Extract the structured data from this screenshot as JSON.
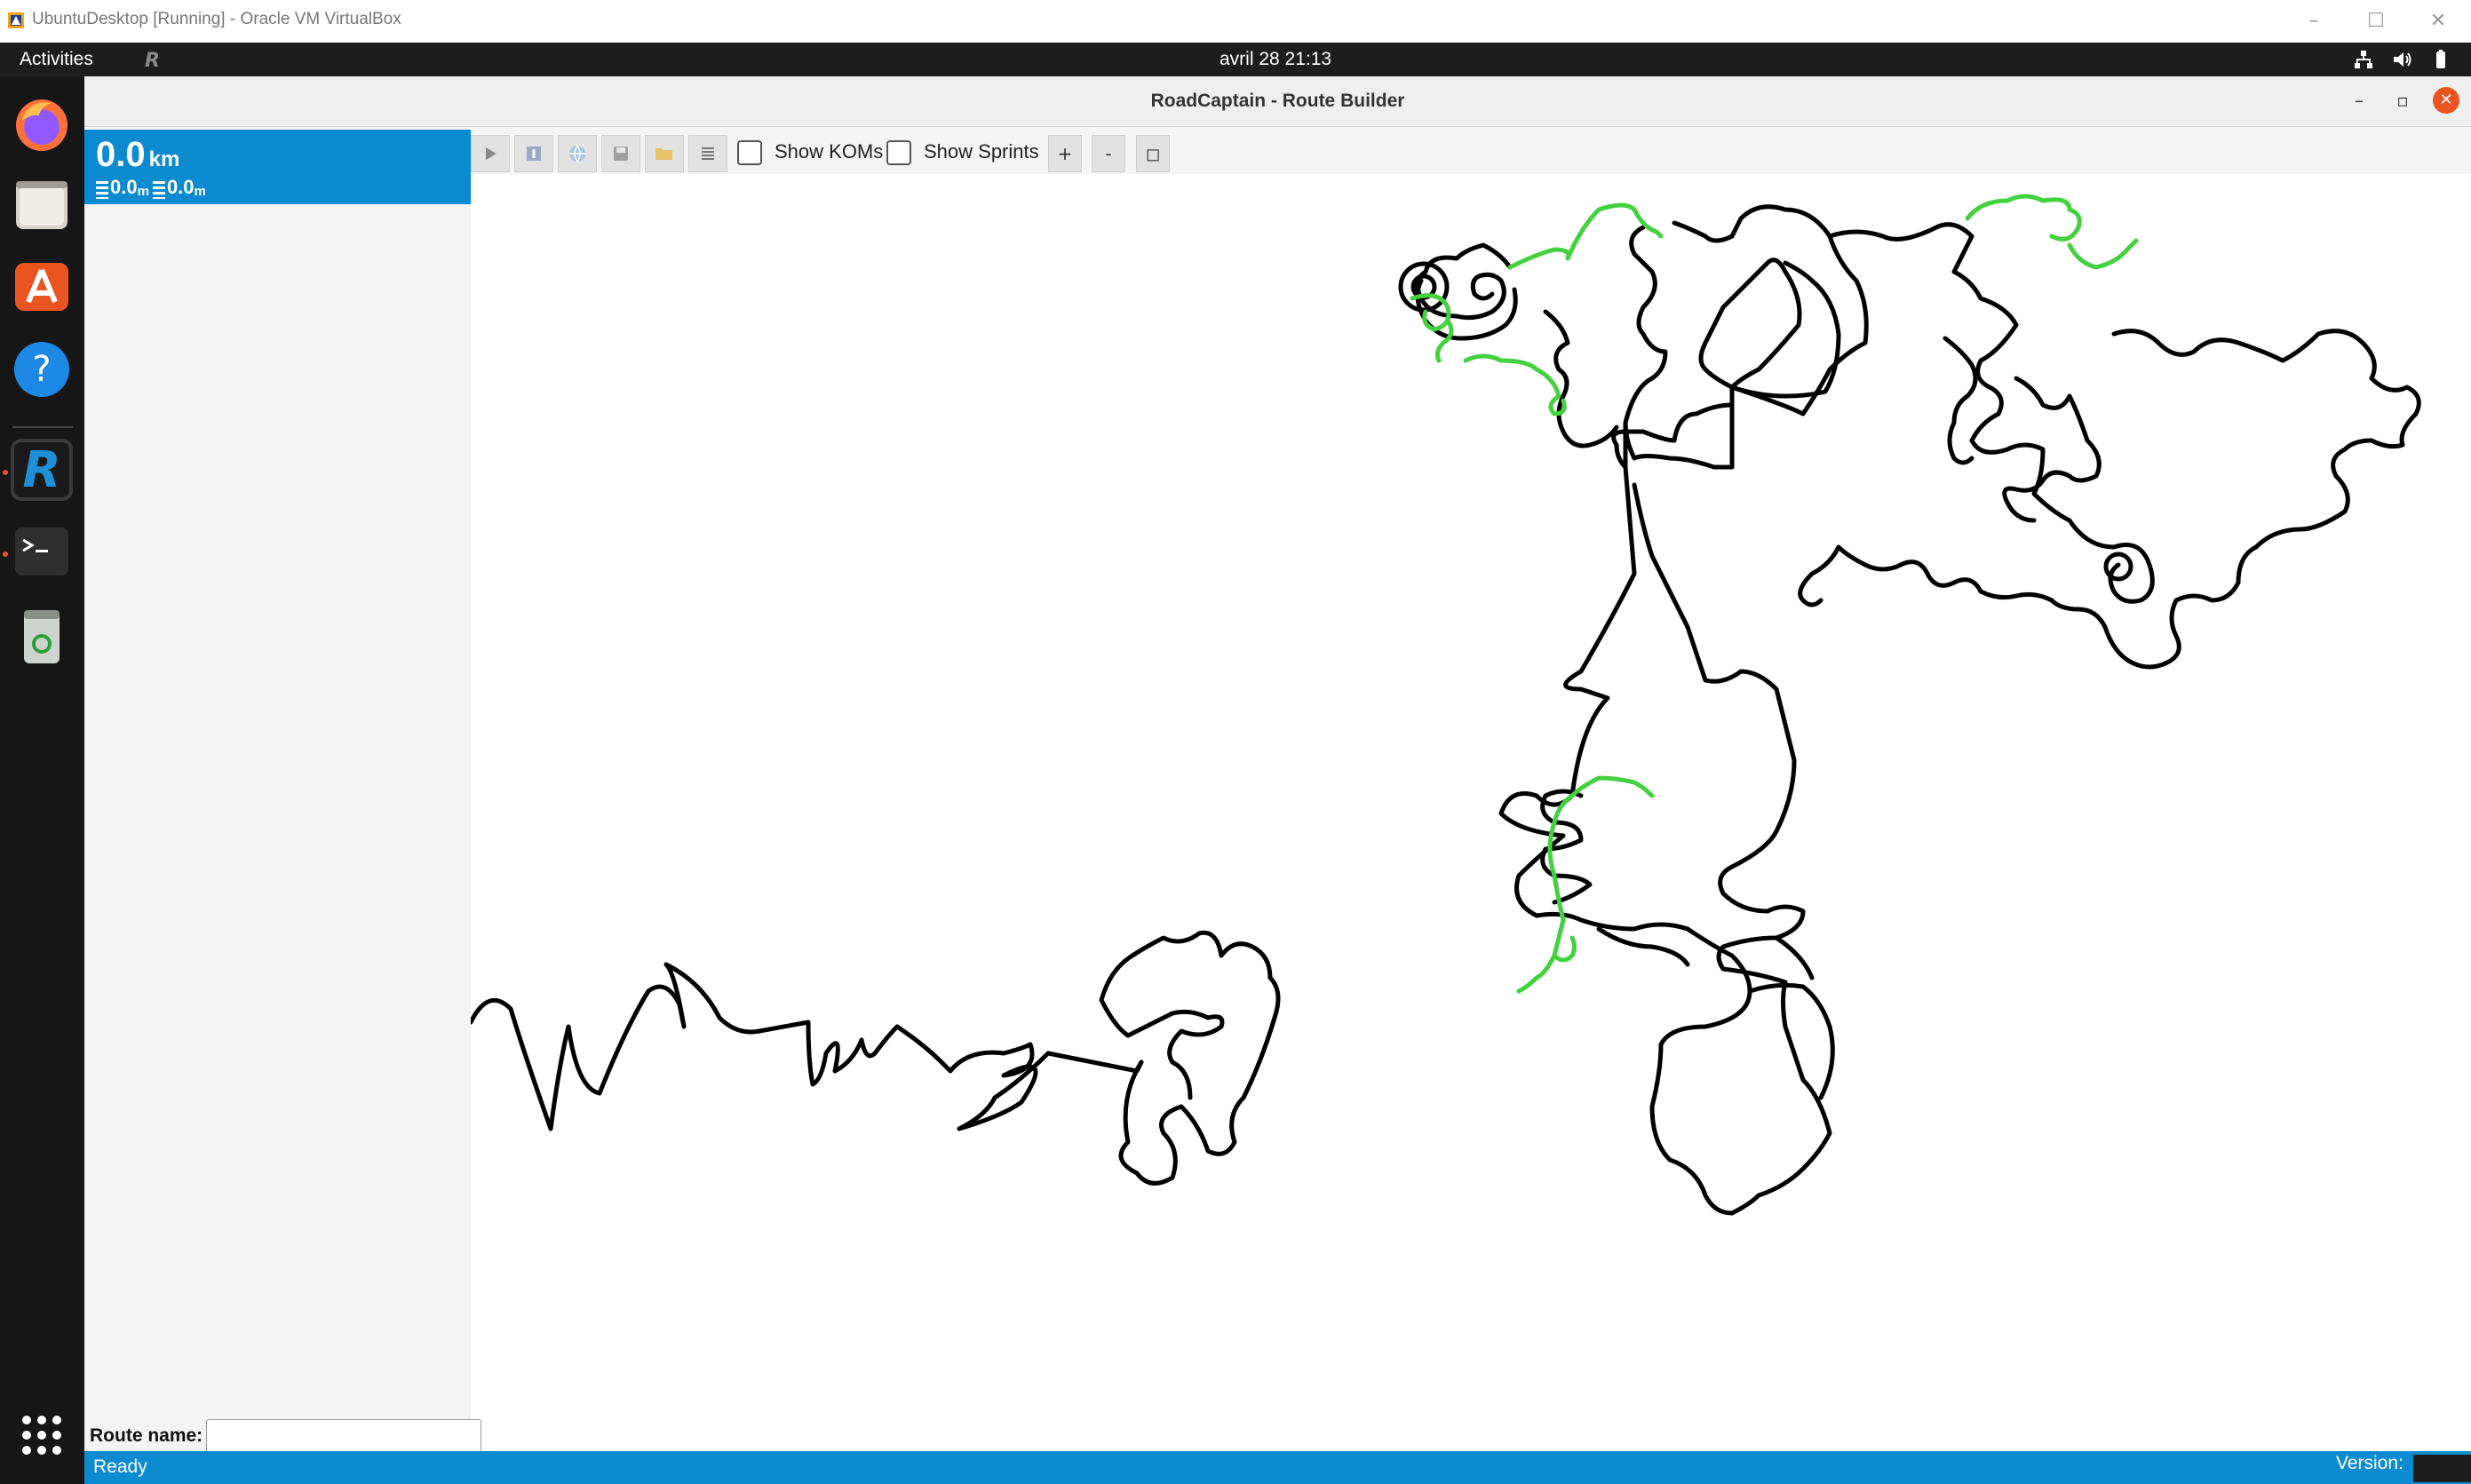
{
  "host_window": {
    "title": "UbuntuDesktop [Running] - Oracle VM VirtualBox",
    "minimize_glyph": "–",
    "maximize_glyph": "☐",
    "close_glyph": "✕"
  },
  "topbar": {
    "activities_label": "Activities",
    "clock": "avril 28  21:13",
    "tray_icons": [
      "network-icon",
      "volume-icon",
      "battery-icon"
    ]
  },
  "dock": {
    "apps": [
      "firefox-icon",
      "files-icon",
      "app-center-icon",
      "help-icon",
      "roadcaptain-icon",
      "terminal-icon",
      "trash-icon"
    ],
    "show_apps": "show-apps-grid-icon"
  },
  "app": {
    "title": "RoadCaptain - Route Builder",
    "minimize_glyph": "–",
    "restore_glyph": "▫",
    "close_glyph": "✕",
    "stats": {
      "distance": "0.0",
      "distance_unit": "km",
      "ascent": "0.0",
      "ascent_unit": "m",
      "descent": "0.0",
      "descent_unit": "m"
    },
    "toolbar": {
      "buttons": [
        "play-icon",
        "strava-icon",
        "globe-icon",
        "save-icon",
        "open-folder-icon",
        "list-icon"
      ],
      "show_koms_label": "Show KOMs",
      "show_koms_checked": false,
      "show_sprints_label": "Show Sprints",
      "show_sprints_checked": false,
      "zoom_in_label": "+",
      "zoom_out_label": "-",
      "reset_zoom_label": "◻"
    },
    "route_name_label": "Route name:",
    "route_name_value": "",
    "status": "Ready",
    "version_label": "Version:",
    "colors": {
      "accent": "#0d8bd1",
      "segment": "#000000",
      "highlight_segment": "#43d13f",
      "close_button": "#e95420"
    }
  }
}
